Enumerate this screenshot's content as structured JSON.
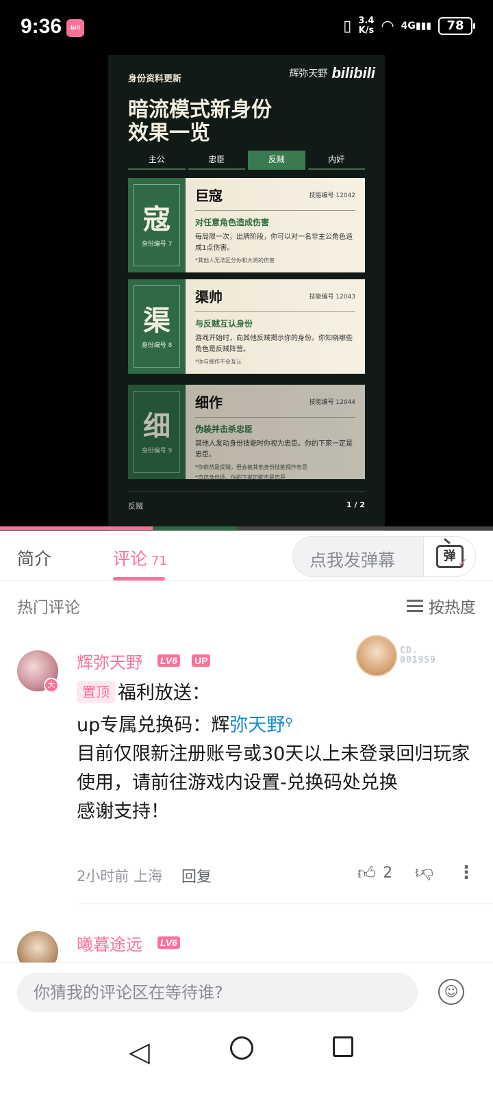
{
  "status_bar": {
    "time": "9:36",
    "app_icon": "bilibili",
    "speed_value": "3.4",
    "speed_unit": "K/s",
    "network": "4G",
    "battery": "78"
  },
  "poster": {
    "tag": "身份资料更新",
    "brand_name": "辉弥天野",
    "brand_logo": "bilibili",
    "title_line1": "暗流模式新身份",
    "title_line2": "效果一览",
    "tabs": [
      "主公",
      "忠臣",
      "反贼",
      "内奸"
    ],
    "active_tab": "反贼",
    "cards": [
      {
        "char": "寇",
        "id_label": "身份编号 7",
        "name": "巨寇",
        "skill_id": "技能编号 12042",
        "ability": "对任意角色造成伤害",
        "desc": "每局限一次，出牌阶段，你可以对一名非主公角色造成1点伤害。",
        "note": "*其他人无法区分你和大将的伤害"
      },
      {
        "char": "渠",
        "id_label": "身份编号 8",
        "name": "渠帅",
        "skill_id": "技能编号 12043",
        "ability": "与反贼互认身份",
        "desc": "游戏开始时，向其他反贼揭示你的身份。你知晓哪些角色是反贼阵营。",
        "note": "*你与细作不会互认"
      },
      {
        "char": "细",
        "id_label": "身份编号 9",
        "name": "细作",
        "skill_id": "技能编号 12044",
        "ability": "伪装并击杀忠臣",
        "desc": "其他人发动身份技能时你视为忠臣。你的下家一定是忠臣。",
        "note": "*你依然是反贼，但会被其他身份技能视作忠臣",
        "note2": "*自选身份场，你的下家可能不是忠臣"
      }
    ],
    "footer_left": "反贼",
    "footer_page": "1 / 2"
  },
  "player": {
    "progress_fraction": 0.31,
    "buffer_fraction": 0.48
  },
  "tabs": {
    "intro": "简介",
    "comments": "评论",
    "comment_count": "71",
    "danmaku_placeholder": "点我发弹幕",
    "danmaku_icon_label": "弹"
  },
  "sort": {
    "hot_label": "热门评论",
    "sort_label": "按热度"
  },
  "comments": [
    {
      "username": "辉弥天野",
      "level": "LV6",
      "up_badge": "UP",
      "avatar_badge": "大",
      "decoration_line1": "CD.",
      "decoration_line2": "001959",
      "pin_tag": "置顶",
      "line1": "福利放送：",
      "line2_prefix": "up专属兑换码：辉",
      "mention": "弥天野",
      "line3": "目前仅限新注册账号或30天以上未登录回归玩家使用，请前往游戏内设置-兑换码处兑换",
      "line4": "感谢支持！",
      "meta": "2小时前 上海",
      "reply": "回复",
      "likes": "2"
    },
    {
      "username": "曦暮途远",
      "level": "LV6"
    }
  ],
  "bottom": {
    "input_placeholder": "你猜我的评论区在等待谁?"
  }
}
